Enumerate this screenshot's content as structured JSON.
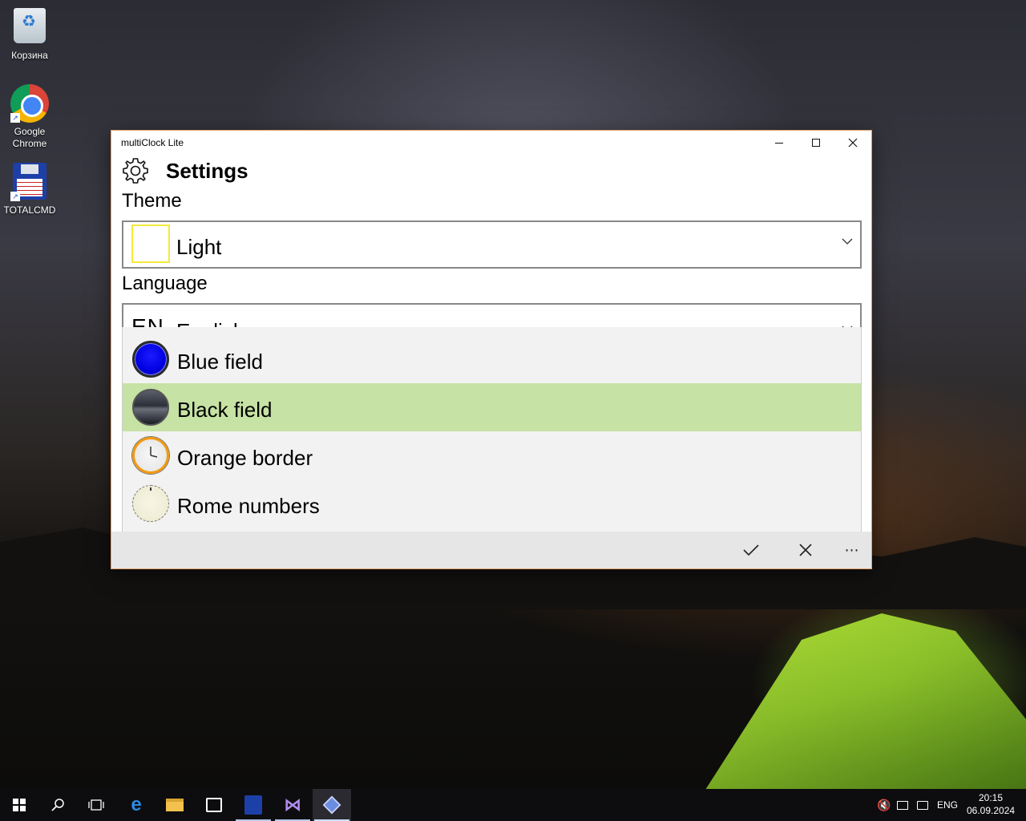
{
  "desktop": {
    "icons": [
      {
        "label": "Корзина",
        "icon": "recycle-bin-icon"
      },
      {
        "label": "Google Chrome",
        "icon": "chrome-icon"
      },
      {
        "label": "TOTALCMD",
        "icon": "floppy-disk-icon"
      }
    ]
  },
  "window": {
    "title": "multiClock Lite",
    "controls": {
      "minimize": "minimize-icon",
      "maximize": "maximize-icon",
      "close": "close-icon"
    }
  },
  "settings": {
    "page_title": "Settings",
    "theme": {
      "label": "Theme",
      "selected": "Light",
      "swatch_color": "#f5ea3a"
    },
    "language": {
      "label": "Language",
      "code": "EN",
      "selected": "English"
    },
    "dropdown": {
      "options": [
        {
          "label": "Blue field",
          "selected": false
        },
        {
          "label": "Black field",
          "selected": true
        },
        {
          "label": "Orange border",
          "selected": false
        },
        {
          "label": "Rome numbers",
          "selected": false
        }
      ],
      "selected_color": "#c6e2a4"
    }
  },
  "command_bar": {
    "accept": "checkmark-icon",
    "cancel": "close-icon",
    "more": "⋯"
  },
  "taskbar": {
    "language": "ENG",
    "time": "20:15",
    "date": "06.09.2024"
  }
}
